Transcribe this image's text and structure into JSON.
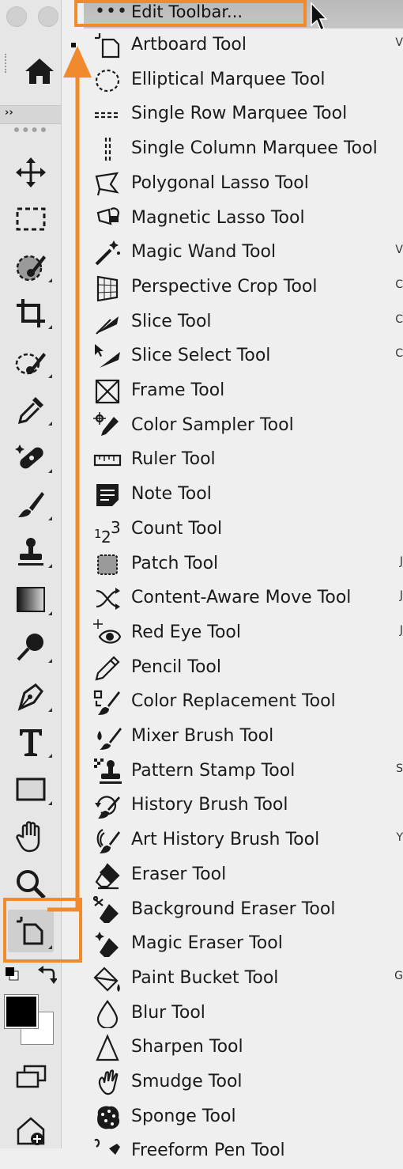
{
  "menu": {
    "header_label": "Edit Toolbar...",
    "header_dots": "•••",
    "items": [
      {
        "label": "Artboard Tool",
        "icon": "artboard-icon",
        "shortcut": "V",
        "checked": true
      },
      {
        "label": "Elliptical Marquee Tool",
        "icon": "elliptical-marquee-icon",
        "shortcut": ""
      },
      {
        "label": "Single Row Marquee Tool",
        "icon": "single-row-marquee-icon",
        "shortcut": ""
      },
      {
        "label": "Single Column Marquee Tool",
        "icon": "single-column-marquee-icon",
        "shortcut": ""
      },
      {
        "label": "Polygonal Lasso Tool",
        "icon": "polygonal-lasso-icon",
        "shortcut": ""
      },
      {
        "label": "Magnetic Lasso Tool",
        "icon": "magnetic-lasso-icon",
        "shortcut": ""
      },
      {
        "label": "Magic Wand Tool",
        "icon": "magic-wand-icon",
        "shortcut": "V"
      },
      {
        "label": "Perspective Crop Tool",
        "icon": "perspective-crop-icon",
        "shortcut": "C"
      },
      {
        "label": "Slice Tool",
        "icon": "slice-icon",
        "shortcut": "C"
      },
      {
        "label": "Slice Select Tool",
        "icon": "slice-select-icon",
        "shortcut": "C"
      },
      {
        "label": "Frame Tool",
        "icon": "frame-icon",
        "shortcut": ""
      },
      {
        "label": "Color Sampler Tool",
        "icon": "color-sampler-icon",
        "shortcut": ""
      },
      {
        "label": "Ruler Tool",
        "icon": "ruler-icon",
        "shortcut": ""
      },
      {
        "label": "Note Tool",
        "icon": "note-icon",
        "shortcut": ""
      },
      {
        "label": "Count Tool",
        "icon": "count-icon",
        "shortcut": ""
      },
      {
        "label": "Patch Tool",
        "icon": "patch-icon",
        "shortcut": "J"
      },
      {
        "label": "Content-Aware Move Tool",
        "icon": "content-aware-move-icon",
        "shortcut": "J"
      },
      {
        "label": "Red Eye Tool",
        "icon": "red-eye-icon",
        "shortcut": "J"
      },
      {
        "label": "Pencil Tool",
        "icon": "pencil-icon",
        "shortcut": ""
      },
      {
        "label": "Color Replacement Tool",
        "icon": "color-replacement-icon",
        "shortcut": ""
      },
      {
        "label": "Mixer Brush Tool",
        "icon": "mixer-brush-icon",
        "shortcut": ""
      },
      {
        "label": "Pattern Stamp Tool",
        "icon": "pattern-stamp-icon",
        "shortcut": "S"
      },
      {
        "label": "History Brush Tool",
        "icon": "history-brush-icon",
        "shortcut": ""
      },
      {
        "label": "Art History Brush Tool",
        "icon": "art-history-brush-icon",
        "shortcut": "Y"
      },
      {
        "label": "Eraser Tool",
        "icon": "eraser-icon",
        "shortcut": ""
      },
      {
        "label": "Background Eraser Tool",
        "icon": "background-eraser-icon",
        "shortcut": ""
      },
      {
        "label": "Magic Eraser Tool",
        "icon": "magic-eraser-icon",
        "shortcut": ""
      },
      {
        "label": "Paint Bucket Tool",
        "icon": "paint-bucket-icon",
        "shortcut": "G"
      },
      {
        "label": "Blur Tool",
        "icon": "blur-icon",
        "shortcut": ""
      },
      {
        "label": "Sharpen Tool",
        "icon": "sharpen-icon",
        "shortcut": ""
      },
      {
        "label": "Smudge Tool",
        "icon": "smudge-icon",
        "shortcut": ""
      },
      {
        "label": "Sponge Tool",
        "icon": "sponge-icon",
        "shortcut": ""
      },
      {
        "label": "Freeform Pen Tool",
        "icon": "freeform-pen-icon",
        "shortcut": ""
      }
    ]
  },
  "toolbar": {
    "collapse_label": "››",
    "tools": [
      "move-icon",
      "rectangular-marquee-icon",
      "object-selection-icon",
      "crop-icon",
      "lasso-brush-icon",
      "eyedropper-icon",
      "healing-brush-icon",
      "brush-icon",
      "clone-stamp-icon",
      "gradient-icon",
      "dodge-icon",
      "pen-icon",
      "type-icon",
      "rectangle-icon",
      "hand-icon",
      "zoom-icon",
      "artboard-icon"
    ],
    "foreground_color": "#000000",
    "background_color": "#ffffff"
  },
  "colors": {
    "annotation": "#f08a2c",
    "menu_bg": "#efefef",
    "toolbar_bg": "#e6e6e6"
  }
}
